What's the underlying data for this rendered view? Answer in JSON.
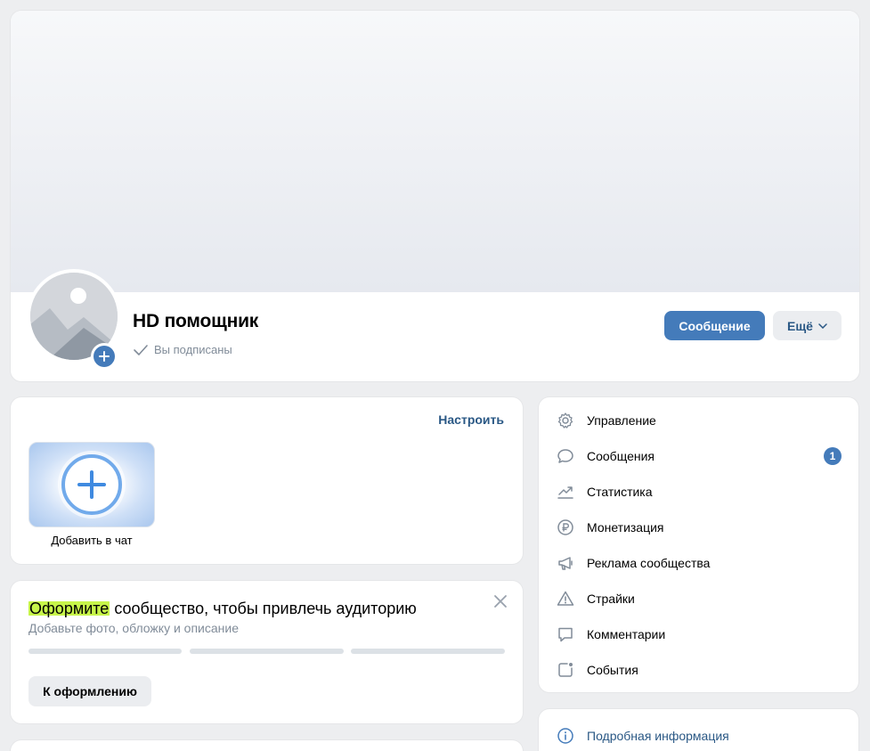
{
  "profile": {
    "name": "HD помощник",
    "status": "Вы подписаны",
    "message_button": "Сообщение",
    "more_button": "Ещё"
  },
  "chat": {
    "setup_link": "Настроить",
    "add_label": "Добавить в чат"
  },
  "design_prompt": {
    "title_highlight": "Оформите",
    "title_rest": " сообщество, чтобы привлечь аудиторию",
    "subtitle": "Добавьте фото, обложку и описание",
    "button": "К оформлению"
  },
  "menu": {
    "items": [
      {
        "label": "Управление",
        "icon": "gear-icon"
      },
      {
        "label": "Сообщения",
        "icon": "chat-bubble-icon",
        "badge": "1"
      },
      {
        "label": "Статистика",
        "icon": "trend-icon"
      },
      {
        "label": "Монетизация",
        "icon": "ruble-icon"
      },
      {
        "label": "Реклама сообщества",
        "icon": "megaphone-icon"
      },
      {
        "label": "Страйки",
        "icon": "warning-icon"
      },
      {
        "label": "Комментарии",
        "icon": "comment-icon"
      },
      {
        "label": "События",
        "icon": "event-icon"
      }
    ]
  },
  "info": {
    "label": "Подробная информация",
    "icon": "info-icon"
  },
  "colors": {
    "accent": "#447bba",
    "link": "#2a5885",
    "highlight": "#c7f54a",
    "background": "#edeef0"
  }
}
